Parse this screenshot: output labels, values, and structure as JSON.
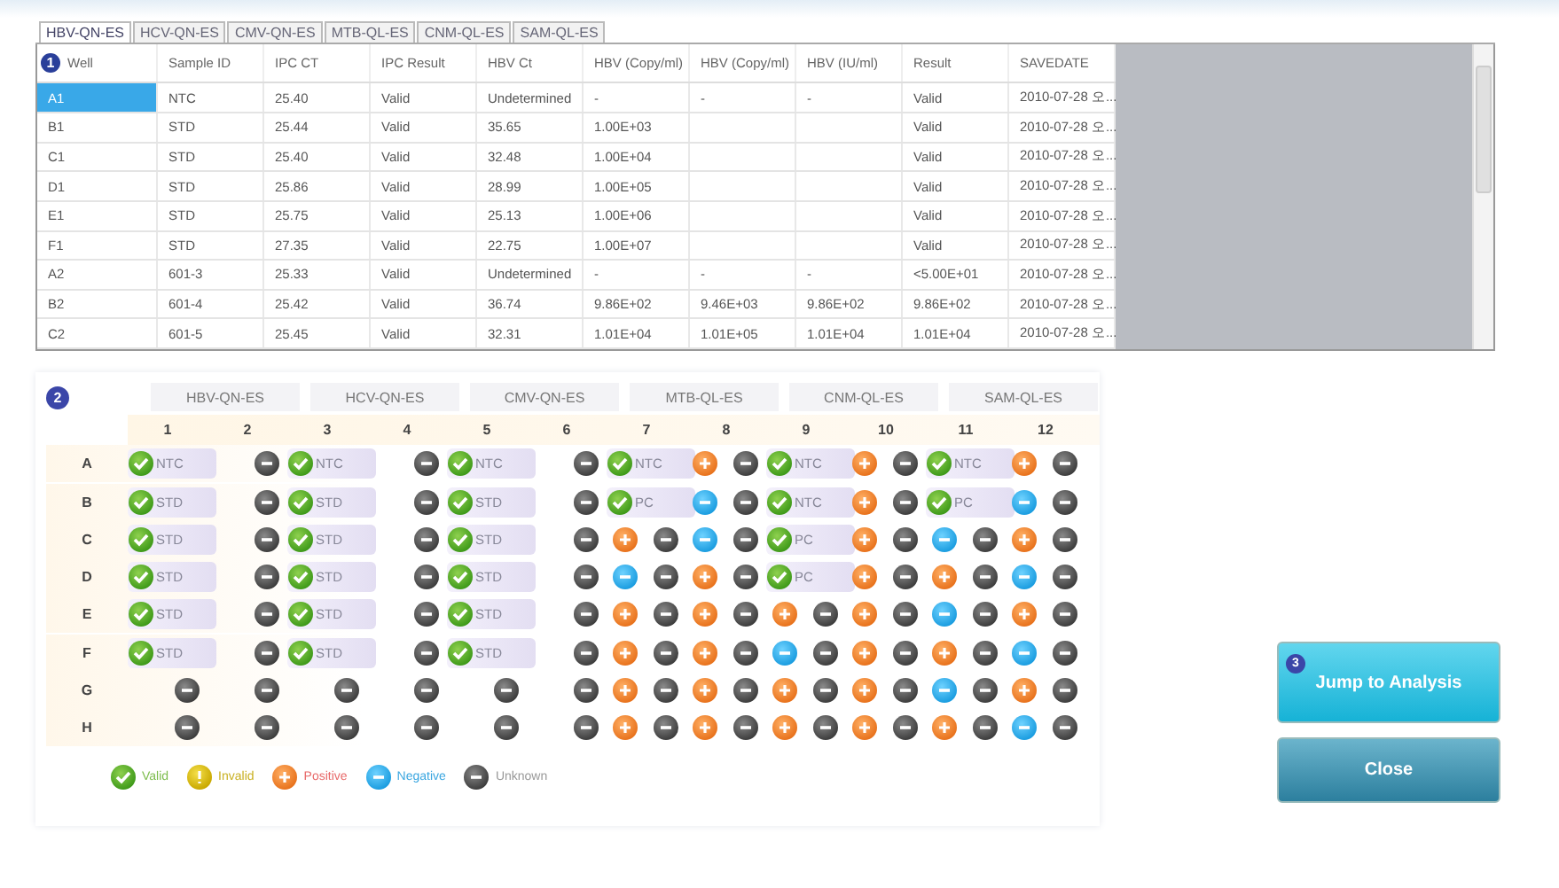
{
  "results": {
    "badge": "1",
    "tabs": [
      {
        "label": "HBV-QN-ES",
        "selected": true
      },
      {
        "label": "HCV-QN-ES",
        "selected": false
      },
      {
        "label": "CMV-QN-ES",
        "selected": false
      },
      {
        "label": "MTB-QL-ES",
        "selected": false
      },
      {
        "label": "CNM-QL-ES",
        "selected": false
      },
      {
        "label": "SAM-QL-ES",
        "selected": false
      }
    ],
    "columns": [
      "Well",
      "Sample ID",
      "IPC CT",
      "IPC Result",
      "HBV Ct",
      "HBV (Copy/ml)",
      "HBV (Copy/ml)",
      "HBV (IU/ml)",
      "Result",
      "SAVEDATE"
    ],
    "rows": [
      {
        "selected": true,
        "cells": [
          "A1",
          "NTC",
          "25.40",
          "Valid",
          "Undetermined",
          "-",
          "-",
          "-",
          "Valid",
          "2010-07-28 오..."
        ]
      },
      {
        "selected": false,
        "cells": [
          "B1",
          "STD",
          "25.44",
          "Valid",
          "35.65",
          "1.00E+03",
          null,
          null,
          "Valid",
          "2010-07-28 오..."
        ]
      },
      {
        "selected": false,
        "cells": [
          "C1",
          "STD",
          "25.40",
          "Valid",
          "32.48",
          "1.00E+04",
          null,
          null,
          "Valid",
          "2010-07-28 오..."
        ]
      },
      {
        "selected": false,
        "cells": [
          "D1",
          "STD",
          "25.86",
          "Valid",
          "28.99",
          "1.00E+05",
          null,
          null,
          "Valid",
          "2010-07-28 오..."
        ]
      },
      {
        "selected": false,
        "cells": [
          "E1",
          "STD",
          "25.75",
          "Valid",
          "25.13",
          "1.00E+06",
          null,
          null,
          "Valid",
          "2010-07-28 오..."
        ]
      },
      {
        "selected": false,
        "cells": [
          "F1",
          "STD",
          "27.35",
          "Valid",
          "22.75",
          "1.00E+07",
          null,
          null,
          "Valid",
          "2010-07-28 오..."
        ]
      },
      {
        "selected": false,
        "cells": [
          "A2",
          "601-3",
          "25.33",
          "Valid",
          "Undetermined",
          "-",
          "-",
          "-",
          "<5.00E+01",
          "2010-07-28 오..."
        ]
      },
      {
        "selected": false,
        "cells": [
          "B2",
          "601-4",
          "25.42",
          "Valid",
          "36.74",
          "9.86E+02",
          "9.46E+03",
          "9.86E+02",
          "9.86E+02",
          "2010-07-28 오..."
        ]
      },
      {
        "selected": false,
        "cells": [
          "C2",
          "601-5",
          "25.45",
          "Valid",
          "32.31",
          "1.01E+04",
          "1.01E+05",
          "1.01E+04",
          "1.01E+04",
          "2010-07-28 오..."
        ]
      }
    ]
  },
  "plate": {
    "badge": "2",
    "assays": [
      "HBV-QN-ES",
      "HCV-QN-ES",
      "CMV-QN-ES",
      "MTB-QL-ES",
      "CNM-QL-ES",
      "SAM-QL-ES"
    ],
    "columns": [
      "1",
      "2",
      "3",
      "4",
      "5",
      "6",
      "7",
      "8",
      "9",
      "10",
      "11",
      "12"
    ],
    "rows": [
      {
        "label": "A",
        "cells": [
          {
            "label": "NTC",
            "dots": [
              {
                "kind": "valid"
              }
            ]
          },
          {
            "dots": [
              {
                "kind": "unknown"
              }
            ]
          },
          {
            "label": "NTC",
            "dots": [
              {
                "kind": "valid"
              }
            ]
          },
          {
            "dots": [
              {
                "kind": "unknown"
              }
            ]
          },
          {
            "label": "NTC",
            "dots": [
              {
                "kind": "valid"
              }
            ]
          },
          {
            "dots": [
              {
                "kind": "unknown"
              }
            ]
          },
          {
            "label": "NTC",
            "dots": [
              {
                "kind": "valid"
              }
            ]
          },
          {
            "dots": [
              {
                "kind": "positive"
              },
              {
                "kind": "unknown"
              }
            ]
          },
          {
            "label": "NTC",
            "dots": [
              {
                "kind": "valid"
              }
            ]
          },
          {
            "dots": [
              {
                "kind": "positive"
              },
              {
                "kind": "unknown"
              }
            ]
          },
          {
            "label": "NTC",
            "dots": [
              {
                "kind": "valid"
              }
            ]
          },
          {
            "dots": [
              {
                "kind": "positive"
              },
              {
                "kind": "unknown"
              }
            ]
          }
        ]
      },
      {
        "label": "B",
        "cells": [
          {
            "label": "STD",
            "dots": [
              {
                "kind": "valid"
              }
            ]
          },
          {
            "dots": [
              {
                "kind": "unknown"
              }
            ]
          },
          {
            "label": "STD",
            "dots": [
              {
                "kind": "valid"
              }
            ]
          },
          {
            "dots": [
              {
                "kind": "unknown"
              }
            ]
          },
          {
            "label": "STD",
            "dots": [
              {
                "kind": "valid"
              }
            ]
          },
          {
            "dots": [
              {
                "kind": "unknown"
              }
            ]
          },
          {
            "label": "PC",
            "dots": [
              {
                "kind": "valid"
              }
            ]
          },
          {
            "dots": [
              {
                "kind": "negative"
              },
              {
                "kind": "unknown"
              }
            ]
          },
          {
            "label": "NTC",
            "dots": [
              {
                "kind": "valid"
              }
            ]
          },
          {
            "dots": [
              {
                "kind": "positive"
              },
              {
                "kind": "unknown"
              }
            ]
          },
          {
            "label": "PC",
            "dots": [
              {
                "kind": "valid"
              }
            ]
          },
          {
            "dots": [
              {
                "kind": "negative"
              },
              {
                "kind": "unknown"
              }
            ]
          }
        ]
      },
      {
        "label": "C",
        "cells": [
          {
            "label": "STD",
            "dots": [
              {
                "kind": "valid"
              }
            ]
          },
          {
            "dots": [
              {
                "kind": "unknown"
              }
            ]
          },
          {
            "label": "STD",
            "dots": [
              {
                "kind": "valid"
              }
            ]
          },
          {
            "dots": [
              {
                "kind": "unknown"
              }
            ]
          },
          {
            "label": "STD",
            "dots": [
              {
                "kind": "valid"
              }
            ]
          },
          {
            "dots": [
              {
                "kind": "unknown"
              }
            ]
          },
          {
            "dots": [
              {
                "kind": "positive"
              },
              {
                "kind": "unknown"
              }
            ]
          },
          {
            "dots": [
              {
                "kind": "negative"
              },
              {
                "kind": "unknown"
              }
            ]
          },
          {
            "label": "PC",
            "dots": [
              {
                "kind": "valid"
              }
            ]
          },
          {
            "dots": [
              {
                "kind": "positive"
              },
              {
                "kind": "unknown"
              }
            ]
          },
          {
            "dots": [
              {
                "kind": "negative"
              },
              {
                "kind": "unknown"
              }
            ]
          },
          {
            "dots": [
              {
                "kind": "positive"
              },
              {
                "kind": "unknown"
              }
            ]
          }
        ]
      },
      {
        "label": "D",
        "cells": [
          {
            "label": "STD",
            "dots": [
              {
                "kind": "valid"
              }
            ]
          },
          {
            "dots": [
              {
                "kind": "unknown"
              }
            ]
          },
          {
            "label": "STD",
            "dots": [
              {
                "kind": "valid"
              }
            ]
          },
          {
            "dots": [
              {
                "kind": "unknown"
              }
            ]
          },
          {
            "label": "STD",
            "dots": [
              {
                "kind": "valid"
              }
            ]
          },
          {
            "dots": [
              {
                "kind": "unknown"
              }
            ]
          },
          {
            "dots": [
              {
                "kind": "negative"
              },
              {
                "kind": "unknown"
              }
            ]
          },
          {
            "dots": [
              {
                "kind": "positive"
              },
              {
                "kind": "unknown"
              }
            ]
          },
          {
            "label": "PC",
            "dots": [
              {
                "kind": "valid"
              }
            ]
          },
          {
            "dots": [
              {
                "kind": "positive"
              },
              {
                "kind": "unknown"
              }
            ]
          },
          {
            "dots": [
              {
                "kind": "positive"
              },
              {
                "kind": "unknown"
              }
            ]
          },
          {
            "dots": [
              {
                "kind": "negative"
              },
              {
                "kind": "unknown"
              }
            ]
          }
        ]
      },
      {
        "label": "E",
        "cells": [
          {
            "label": "STD",
            "dots": [
              {
                "kind": "valid"
              }
            ]
          },
          {
            "dots": [
              {
                "kind": "unknown"
              }
            ]
          },
          {
            "label": "STD",
            "dots": [
              {
                "kind": "valid"
              }
            ]
          },
          {
            "dots": [
              {
                "kind": "unknown"
              }
            ]
          },
          {
            "label": "STD",
            "dots": [
              {
                "kind": "valid"
              }
            ]
          },
          {
            "dots": [
              {
                "kind": "unknown"
              }
            ]
          },
          {
            "dots": [
              {
                "kind": "positive"
              },
              {
                "kind": "unknown"
              }
            ]
          },
          {
            "dots": [
              {
                "kind": "positive"
              },
              {
                "kind": "unknown"
              }
            ]
          },
          {
            "dots": [
              {
                "kind": "positive"
              },
              {
                "kind": "unknown"
              }
            ]
          },
          {
            "dots": [
              {
                "kind": "positive"
              },
              {
                "kind": "unknown"
              }
            ]
          },
          {
            "dots": [
              {
                "kind": "negative"
              },
              {
                "kind": "unknown"
              }
            ]
          },
          {
            "dots": [
              {
                "kind": "positive"
              },
              {
                "kind": "unknown"
              }
            ]
          }
        ]
      },
      {
        "label": "F",
        "cells": [
          {
            "label": "STD",
            "dots": [
              {
                "kind": "valid"
              }
            ]
          },
          {
            "dots": [
              {
                "kind": "unknown"
              }
            ]
          },
          {
            "label": "STD",
            "dots": [
              {
                "kind": "valid"
              }
            ]
          },
          {
            "dots": [
              {
                "kind": "unknown"
              }
            ]
          },
          {
            "label": "STD",
            "dots": [
              {
                "kind": "valid"
              }
            ]
          },
          {
            "dots": [
              {
                "kind": "unknown"
              }
            ]
          },
          {
            "dots": [
              {
                "kind": "positive"
              },
              {
                "kind": "unknown"
              }
            ]
          },
          {
            "dots": [
              {
                "kind": "positive"
              },
              {
                "kind": "unknown"
              }
            ]
          },
          {
            "dots": [
              {
                "kind": "negative"
              },
              {
                "kind": "unknown"
              }
            ]
          },
          {
            "dots": [
              {
                "kind": "positive"
              },
              {
                "kind": "unknown"
              }
            ]
          },
          {
            "dots": [
              {
                "kind": "positive"
              },
              {
                "kind": "unknown"
              }
            ]
          },
          {
            "dots": [
              {
                "kind": "negative"
              },
              {
                "kind": "unknown"
              }
            ]
          }
        ]
      },
      {
        "label": "G",
        "cells": [
          {
            "dots": [
              {
                "kind": "unknown"
              }
            ]
          },
          {
            "dots": [
              {
                "kind": "unknown"
              }
            ]
          },
          {
            "dots": [
              {
                "kind": "unknown"
              }
            ]
          },
          {
            "dots": [
              {
                "kind": "unknown"
              }
            ]
          },
          {
            "dots": [
              {
                "kind": "unknown"
              }
            ]
          },
          {
            "dots": [
              {
                "kind": "unknown"
              }
            ]
          },
          {
            "dots": [
              {
                "kind": "positive"
              },
              {
                "kind": "unknown"
              }
            ]
          },
          {
            "dots": [
              {
                "kind": "positive"
              },
              {
                "kind": "unknown"
              }
            ]
          },
          {
            "dots": [
              {
                "kind": "positive"
              },
              {
                "kind": "unknown"
              }
            ]
          },
          {
            "dots": [
              {
                "kind": "positive"
              },
              {
                "kind": "unknown"
              }
            ]
          },
          {
            "dots": [
              {
                "kind": "negative"
              },
              {
                "kind": "unknown"
              }
            ]
          },
          {
            "dots": [
              {
                "kind": "positive"
              },
              {
                "kind": "unknown"
              }
            ]
          }
        ]
      },
      {
        "label": "H",
        "cells": [
          {
            "dots": [
              {
                "kind": "unknown"
              }
            ]
          },
          {
            "dots": [
              {
                "kind": "unknown"
              }
            ]
          },
          {
            "dots": [
              {
                "kind": "unknown"
              }
            ]
          },
          {
            "dots": [
              {
                "kind": "unknown"
              }
            ]
          },
          {
            "dots": [
              {
                "kind": "unknown"
              }
            ]
          },
          {
            "dots": [
              {
                "kind": "unknown"
              }
            ]
          },
          {
            "dots": [
              {
                "kind": "positive"
              },
              {
                "kind": "unknown"
              }
            ]
          },
          {
            "dots": [
              {
                "kind": "positive"
              },
              {
                "kind": "unknown"
              }
            ]
          },
          {
            "dots": [
              {
                "kind": "positive"
              },
              {
                "kind": "unknown"
              }
            ]
          },
          {
            "dots": [
              {
                "kind": "positive"
              },
              {
                "kind": "unknown"
              }
            ]
          },
          {
            "dots": [
              {
                "kind": "positive"
              },
              {
                "kind": "unknown"
              }
            ]
          },
          {
            "dots": [
              {
                "kind": "negative"
              },
              {
                "kind": "unknown"
              }
            ]
          }
        ]
      }
    ],
    "legend": [
      {
        "kind": "valid",
        "label": "Valid"
      },
      {
        "kind": "invalid",
        "label": "Invalid"
      },
      {
        "kind": "positive",
        "label": "Positive"
      },
      {
        "kind": "negative",
        "label": "Negative"
      },
      {
        "kind": "unknown",
        "label": "Unknown"
      }
    ]
  },
  "buttons": [
    {
      "kind": "primary",
      "label": "Jump to Analysis",
      "badge": "3"
    },
    {
      "kind": "secondary",
      "label": "Close"
    }
  ]
}
